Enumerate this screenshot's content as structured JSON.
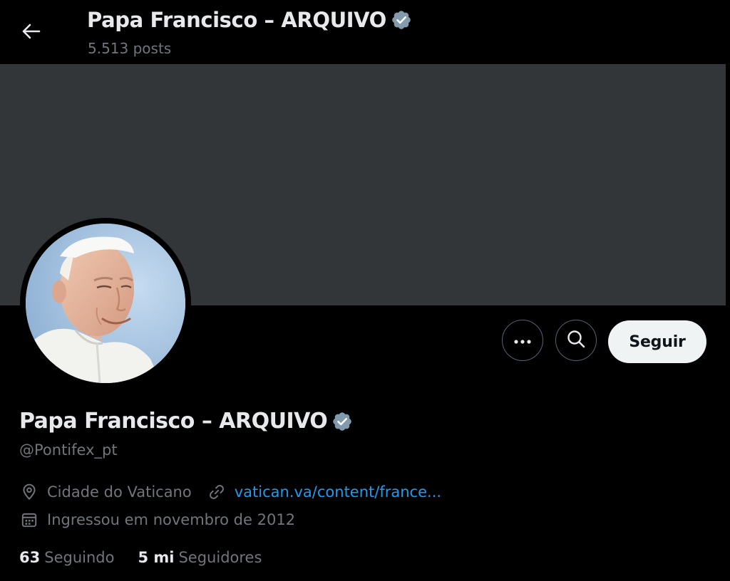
{
  "header": {
    "title": "Papa Francisco – ARQUIVO",
    "posts_count": "5.513 posts",
    "back_icon": "arrow-left-icon"
  },
  "profile": {
    "name": "Papa Francisco – ARQUIVO",
    "handle": "@Pontifex_pt",
    "verified_icon": "verified-badge-icon",
    "location": "Cidade do Vaticano",
    "website": "vatican.va/content/france...",
    "joined": "Ingressou em novembro de 2012",
    "following_count": "63",
    "following_label": "Seguindo",
    "followers_count": "5 mi",
    "followers_label": "Seguidores"
  },
  "actions": {
    "more_icon": "more-icon",
    "search_icon": "search-icon",
    "follow_label": "Seguir"
  },
  "colors": {
    "background": "#000000",
    "banner": "#333639",
    "text_primary": "#e7e9ea",
    "text_secondary": "#71767b",
    "link": "#1d9bf0",
    "follow_button_bg": "#eff3f4",
    "verified_badge": "#829aab"
  }
}
